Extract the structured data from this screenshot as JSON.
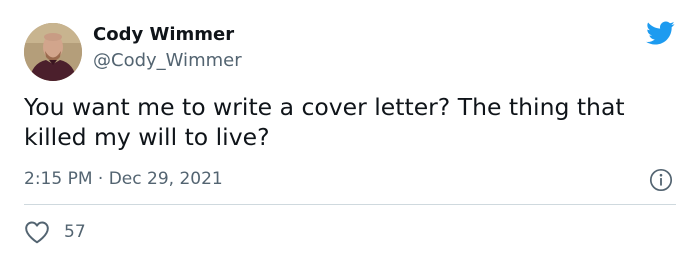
{
  "author": {
    "display_name": "Cody Wimmer",
    "handle": "@Cody_Wimmer"
  },
  "tweet": {
    "text": "You want me to write a cover letter? The thing that killed my will to live?",
    "time": "2:15 PM",
    "separator": "·",
    "date": "Dec 29, 2021"
  },
  "engagement": {
    "likes": "57"
  },
  "icons": {
    "brand": "twitter-bird-icon",
    "info": "info-icon",
    "like": "heart-icon"
  },
  "colors": {
    "brand": "#1d9bf0",
    "text": "#0f1419",
    "secondary": "#536471",
    "divider": "#cfd9de"
  }
}
